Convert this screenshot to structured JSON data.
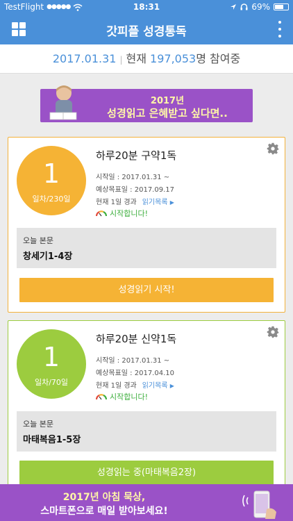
{
  "status_bar": {
    "carrier": "TestFlight",
    "signal": "●●●●●",
    "time": "18:31",
    "battery": "69%",
    "battery_level": 0.69
  },
  "nav": {
    "title": "갓피플 성경통독"
  },
  "summary": {
    "date": "2017.01.31",
    "separator": "|",
    "prefix": "현재",
    "count": "197,053",
    "suffix": "명 참여중"
  },
  "top_banner": {
    "line1": "2017년",
    "line2": "성경읽고 은혜받고 싶다면.."
  },
  "plans": [
    {
      "day": "1",
      "day_label": "일차/230일",
      "title": "하루20분 구약1독",
      "start_date": "시작일 : 2017.01.31 ~",
      "target_date": "예상목표일 : 2017.09.17",
      "progress": "현재 1일 경과",
      "list_link": "읽기목록",
      "status": "시작합니다!",
      "today_label": "오늘 본문",
      "today_text": "창세기1-4장",
      "action": "성경읽기 시작!"
    },
    {
      "day": "1",
      "day_label": "일차/70일",
      "title": "하루20분 신약1독",
      "start_date": "시작일 : 2017.01.31 ~",
      "target_date": "예상목표일 : 2017.04.10",
      "progress": "현재 1일 경과",
      "list_link": "읽기목록",
      "status": "시작합니다!",
      "today_label": "오늘 본문",
      "today_text": "마태복음1-5장",
      "action": "성경읽는 중(마태복음2장)"
    }
  ],
  "bottom_banner": {
    "line1": "2017년 아침 묵상,",
    "line2": "스마트폰으로 매일 받아보세요!"
  },
  "colors": {
    "primary": "#4a90d9",
    "orange": "#f5b335",
    "green": "#9ccc3f",
    "purple": "#9a52c7"
  },
  "icons": [
    "wifi-icon",
    "location-icon",
    "headphones-icon",
    "menu-grid-icon",
    "more-vertical-icon",
    "gear-icon",
    "gauge-icon",
    "triangle-right-icon"
  ]
}
